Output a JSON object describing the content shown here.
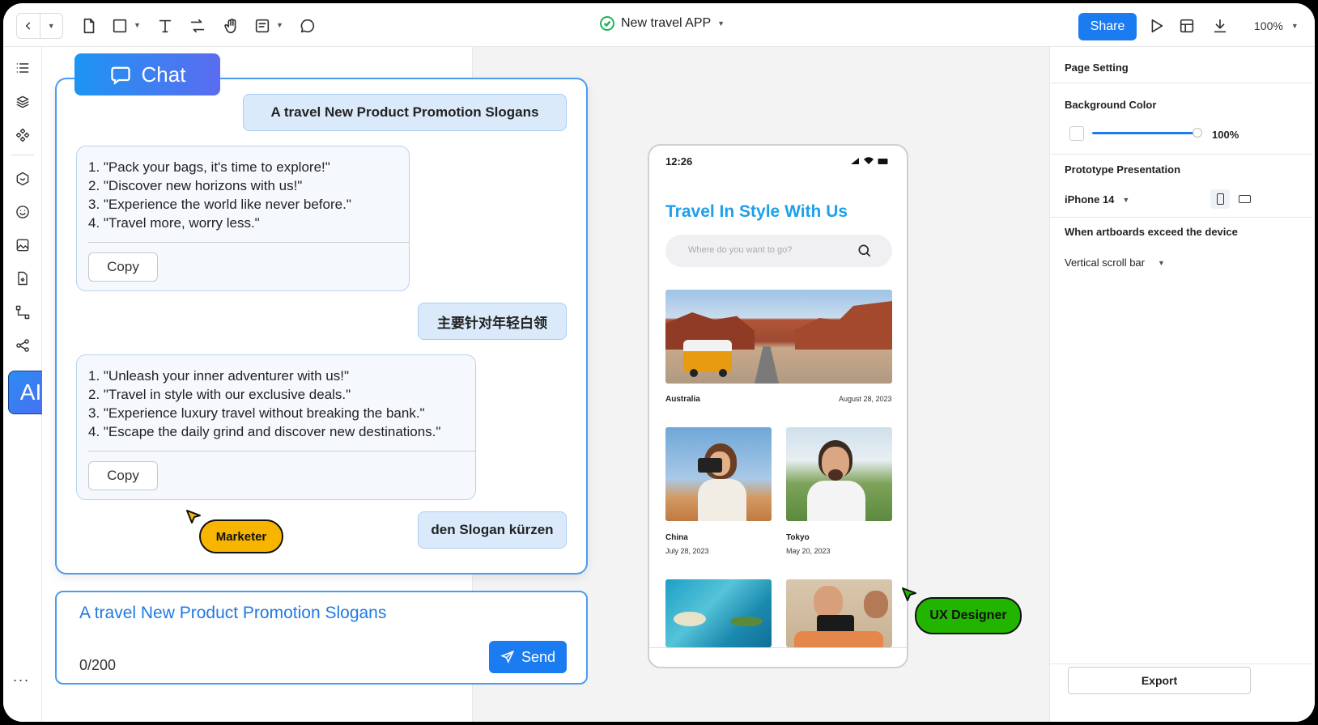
{
  "toolbar": {
    "doc_title": "New travel APP",
    "share_label": "Share",
    "zoom": "100%"
  },
  "rail": {
    "ai_label": "AI",
    "more_label": "..."
  },
  "chat": {
    "tab_label": "Chat",
    "messages": {
      "user1": "A travel New Product Promotion Slogans",
      "ai1": [
        "1. \"Pack your bags, it's time to explore!\"",
        "2. \"Discover new horizons with us!\"",
        "3. \"Experience the world like never before.\"",
        "4. \"Travel more, worry less.\""
      ],
      "user2": "主要针对年轻白领",
      "ai2": [
        "1. \"Unleash your inner adventurer with us!\"",
        "2. \"Travel in style with our exclusive deals.\"",
        "3. \"Experience luxury travel without breaking the bank.\"",
        "4. \"Escape the daily grind and discover new destinations.\""
      ],
      "user3": "den Slogan kürzen"
    },
    "copy_label": "Copy",
    "marketer_tag": "Marketer",
    "input_value": "A travel New Product Promotion Slogans",
    "counter": "0/200",
    "send_label": "Send"
  },
  "phone": {
    "time": "12:26",
    "title": "Travel In Style With Us",
    "search_placeholder": "Where do you want to go?",
    "cards": [
      {
        "place": "Australia",
        "date": "August 28, 2023"
      },
      {
        "place": "China",
        "date": "July 28, 2023"
      },
      {
        "place": "Tokyo",
        "date": "May 20, 2023"
      }
    ],
    "ux_tag": "UX Designer"
  },
  "right_panel": {
    "page_setting": "Page Setting",
    "background_color": "Background Color",
    "opacity": "100%",
    "prototype_presentation": "Prototype Presentation",
    "device": "iPhone 14",
    "exceed_label": "When artboards exceed the device",
    "scroll_option": "Vertical scroll bar",
    "export_label": "Export"
  },
  "colors": {
    "accent": "#1b7cf2",
    "marketer": "#f7b500",
    "ux_designer": "#22b500"
  }
}
